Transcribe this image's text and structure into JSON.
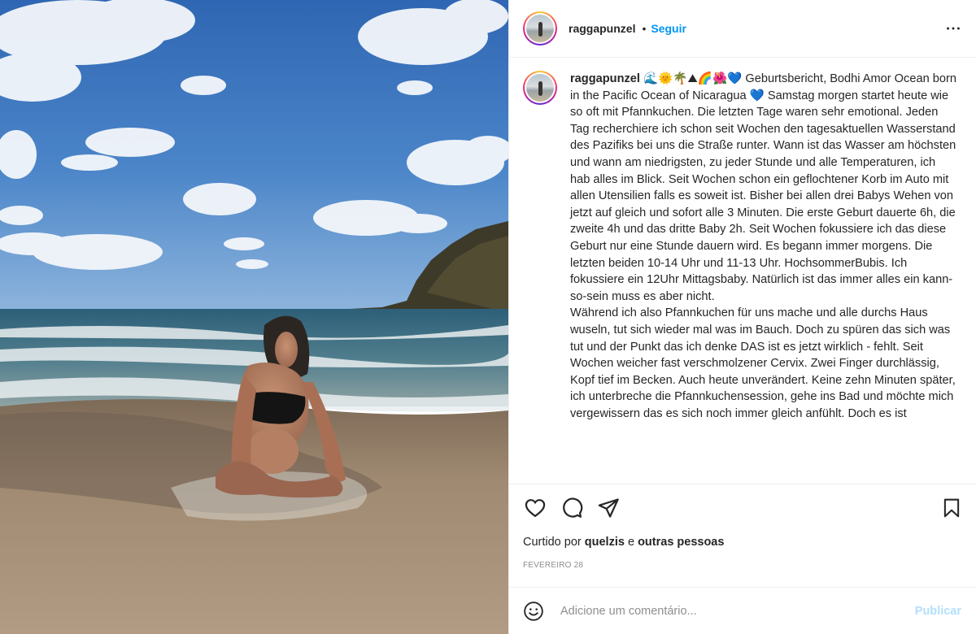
{
  "post": {
    "username": "raggapunzel",
    "follow_label": "Seguir",
    "separator": "•",
    "caption_emojis": "🌊🌞🌴⛰🌈🌺💙",
    "caption_text": " Geburtsbericht, Bodhi Amor Ocean born in the Pacific Ocean of Nicaragua 💙 Samstag morgen startet heute wie so oft mit Pfannkuchen. Die letzten Tage waren sehr emotional. Jeden Tag recherchiere ich schon seit Wochen den tagesaktuellen Wasserstand des Pazifiks bei uns die Straße runter. Wann ist das Wasser am höchsten und wann am niedrigsten, zu jeder Stunde und alle Temperaturen, ich hab alles im Blick. Seit Wochen schon ein geflochtener Korb im Auto mit allen Utensilien falls es soweit ist. Bisher bei allen drei Babys Wehen von jetzt auf gleich und sofort alle 3 Minuten. Die erste Geburt dauerte 6h, die zweite 4h und das dritte Baby 2h. Seit Wochen fokussiere ich das diese Geburt nur eine Stunde dauern wird. Es begann immer morgens. Die letzten beiden 10-14 Uhr und 11-13 Uhr. HochsommerBubis. Ich fokussiere ein 12Uhr Mittagsbaby. Natürlich ist das immer alles ein kann-so-sein muss es aber nicht.\nWährend ich also Pfannkuchen für uns mache und alle durchs Haus wuseln, tut sich wieder mal was im Bauch. Doch zu spüren das sich was tut und der Punkt das ich denke DAS ist es jetzt wirklich - fehlt. Seit Wochen weicher fast verschmolzener Cervix. Zwei Finger durchlässig, Kopf tief im Becken. Auch heute unverändert. Keine zehn Minuten später, ich unterbreche die Pfannkuchensession, gehe ins Bad und möchte mich vergewissern das es sich noch immer gleich anfühlt. Doch es ist",
    "likes_prefix": "Curtido por",
    "likes_user": "quelzis",
    "likes_joiner": "e",
    "likes_others": "outras pessoas",
    "date": "FEVEREIRO 28"
  },
  "icons": {
    "more": "more-options-icon",
    "like": "heart-icon",
    "comment": "comment-icon",
    "share": "paper-plane-icon",
    "save": "bookmark-icon",
    "emoji": "smiley-icon"
  },
  "comment_box": {
    "placeholder": "Adicione um comentário...",
    "publish_label": "Publicar"
  },
  "colors": {
    "accent": "#0095f6",
    "publish_disabled": "#b2dffc",
    "text": "#262626",
    "secondary": "#8e8e8e"
  }
}
